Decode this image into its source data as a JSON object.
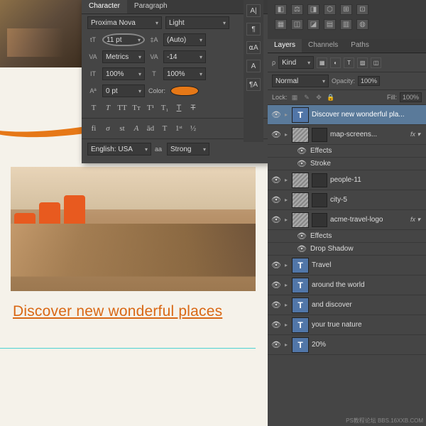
{
  "character_panel": {
    "tabs": {
      "character": "Character",
      "paragraph": "Paragraph"
    },
    "font_family": "Proxima Nova",
    "font_weight": "Light",
    "size": "11 pt",
    "leading": "(Auto)",
    "kerning": "Metrics",
    "tracking": "-14",
    "vscale": "100%",
    "hscale": "100%",
    "baseline": "0 pt",
    "color_label": "Color:",
    "color_value": "#e67817",
    "lang": "English: USA",
    "aa_label": "aa",
    "aa_mode": "Strong"
  },
  "headline_text": "Discover new wonderful places",
  "swatch_icons": [
    "◧",
    "⚖",
    "◨",
    "⬡",
    "⊞",
    "⊡",
    "▦",
    "◫",
    "◪",
    "▤",
    "▥",
    "◍"
  ],
  "layers_panel": {
    "tabs": {
      "layers": "Layers",
      "channels": "Channels",
      "paths": "Paths"
    },
    "kind_label": "Kind",
    "blend_mode": "Normal",
    "opacity_label": "Opacity:",
    "opacity_value": "100%",
    "lock_label": "Lock:",
    "fill_label": "Fill:",
    "fill_value": "100%",
    "layers": [
      {
        "name": "Discover new wonderful pla...",
        "type": "T",
        "sel": true
      },
      {
        "name": "map-screens...",
        "type": "img",
        "fx": true,
        "effects": [
          "Effects",
          "Stroke"
        ]
      },
      {
        "name": "people-11",
        "type": "img"
      },
      {
        "name": "city-5",
        "type": "img"
      },
      {
        "name": "acme-travel-logo",
        "type": "img",
        "fx": true,
        "effects": [
          "Effects",
          "Drop Shadow"
        ]
      },
      {
        "name": "Travel",
        "type": "T"
      },
      {
        "name": "around the world",
        "type": "T"
      },
      {
        "name": "and discover",
        "type": "T"
      },
      {
        "name": "your true nature",
        "type": "T"
      },
      {
        "name": "20%",
        "type": "T"
      }
    ]
  },
  "watermark": "PS教程论坛\nBBS.16XXB.COM"
}
